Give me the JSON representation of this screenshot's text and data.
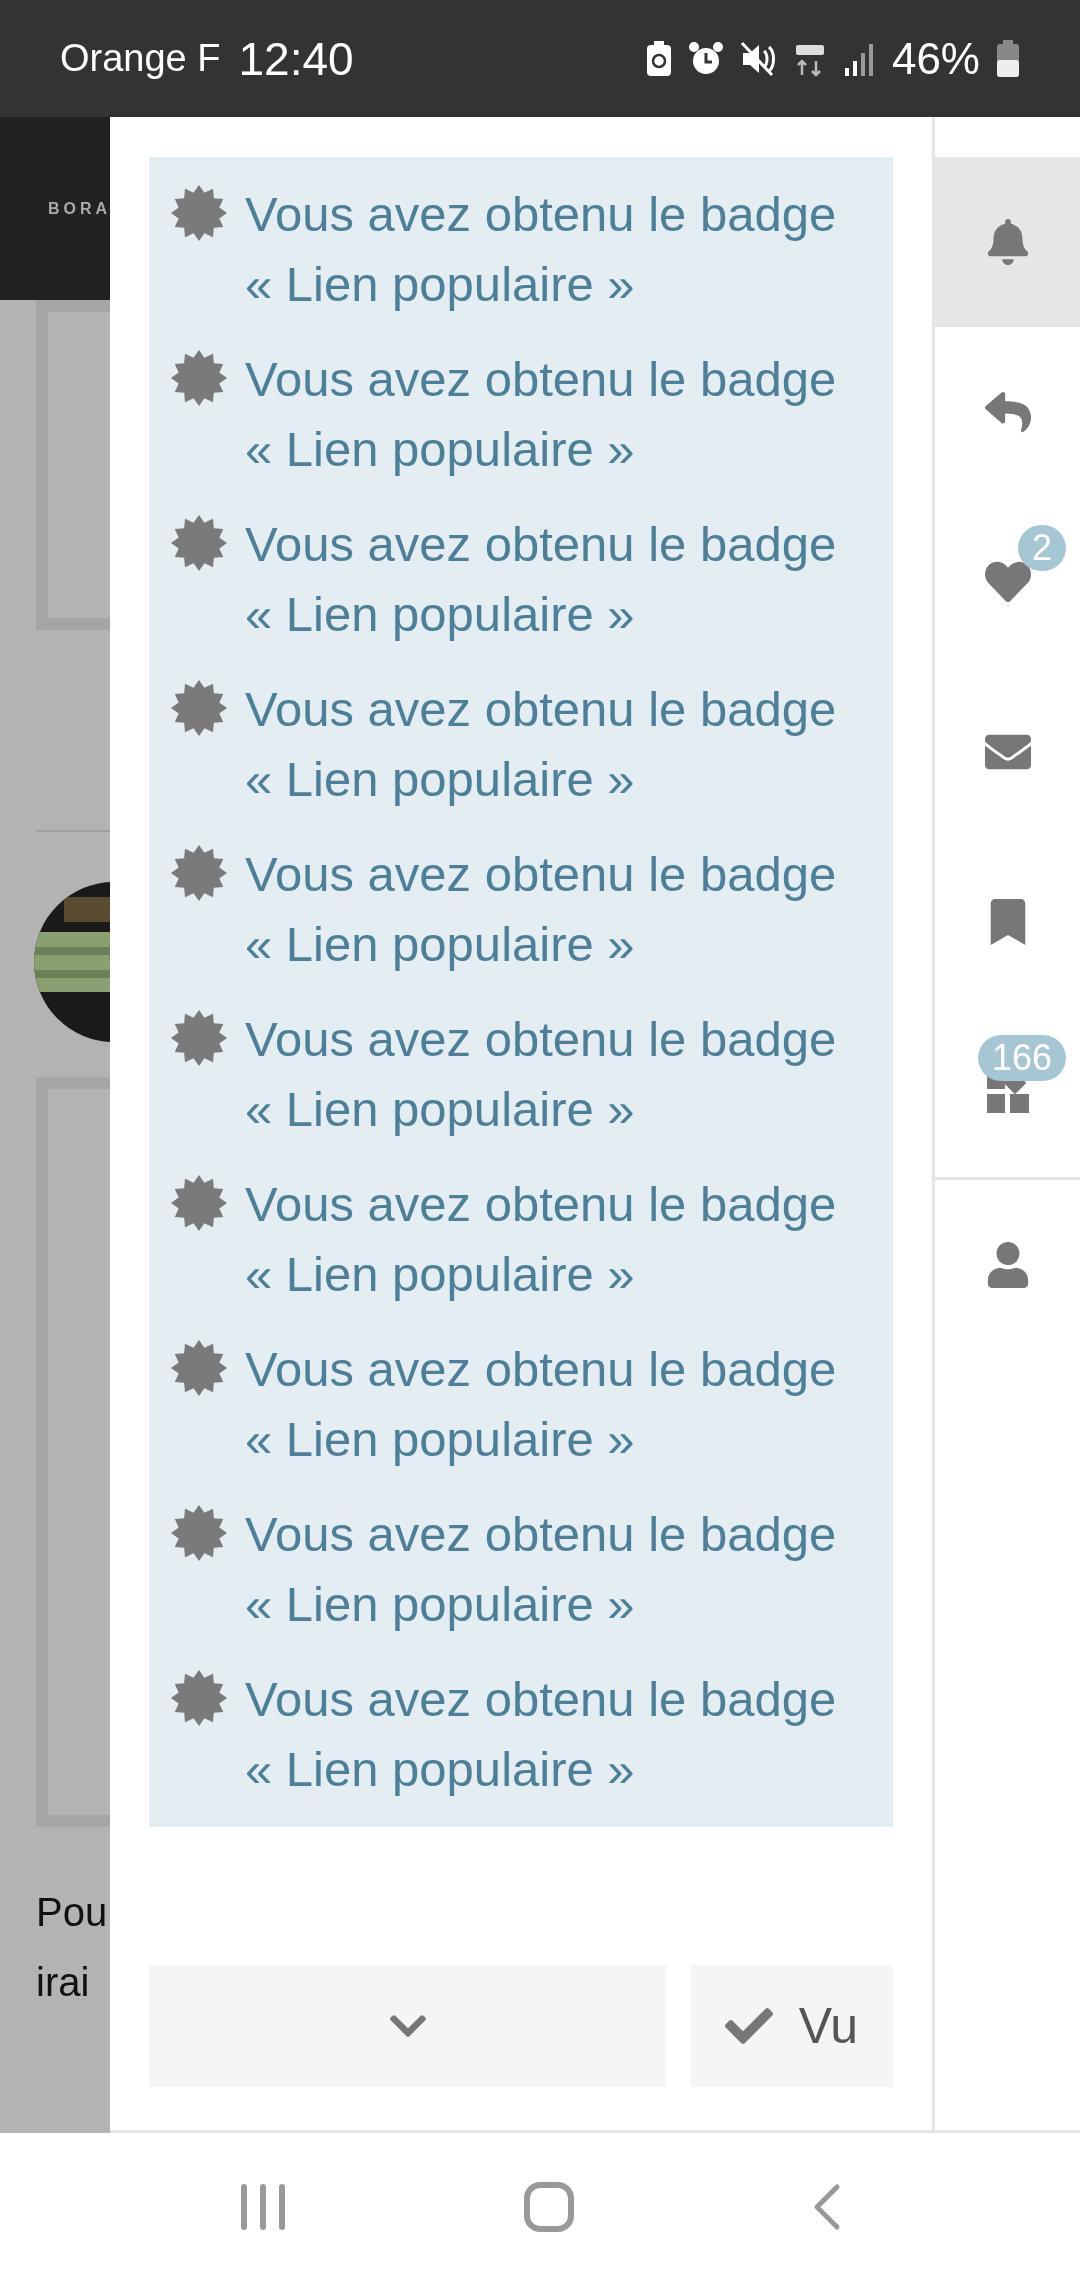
{
  "status_bar": {
    "carrier": "Orange F",
    "time": "12:40",
    "battery": "46%"
  },
  "background_page": {
    "logo": "BORA",
    "text_lines": [
      "Pou",
      "irai"
    ]
  },
  "notifications": [
    {
      "title": "Vous avez obtenu le badge",
      "detail": "« Lien populaire »"
    },
    {
      "title": "Vous avez obtenu le badge",
      "detail": "« Lien populaire »"
    },
    {
      "title": "Vous avez obtenu le badge",
      "detail": "« Lien populaire »"
    },
    {
      "title": "Vous avez obtenu le badge",
      "detail": "« Lien populaire »"
    },
    {
      "title": "Vous avez obtenu le badge",
      "detail": "« Lien populaire »"
    },
    {
      "title": "Vous avez obtenu le badge",
      "detail": "« Lien populaire »"
    },
    {
      "title": "Vous avez obtenu le badge",
      "detail": "« Lien populaire »"
    },
    {
      "title": "Vous avez obtenu le badge",
      "detail": "« Lien populaire »"
    },
    {
      "title": "Vous avez obtenu le badge",
      "detail": "« Lien populaire »"
    },
    {
      "title": "Vous avez obtenu le badge",
      "detail": "« Lien populaire »"
    }
  ],
  "actions": {
    "dismiss_label": "Vu"
  },
  "sidebar": [
    {
      "kind": "bell",
      "selected": true
    },
    {
      "kind": "reply",
      "selected": false
    },
    {
      "kind": "heart",
      "selected": false,
      "badge": "2"
    },
    {
      "kind": "mail",
      "selected": false
    },
    {
      "kind": "bookmark",
      "selected": false
    },
    {
      "kind": "blocks",
      "selected": false,
      "badge": "166"
    },
    {
      "kind": "user",
      "selected": false,
      "divider_before": true
    }
  ]
}
